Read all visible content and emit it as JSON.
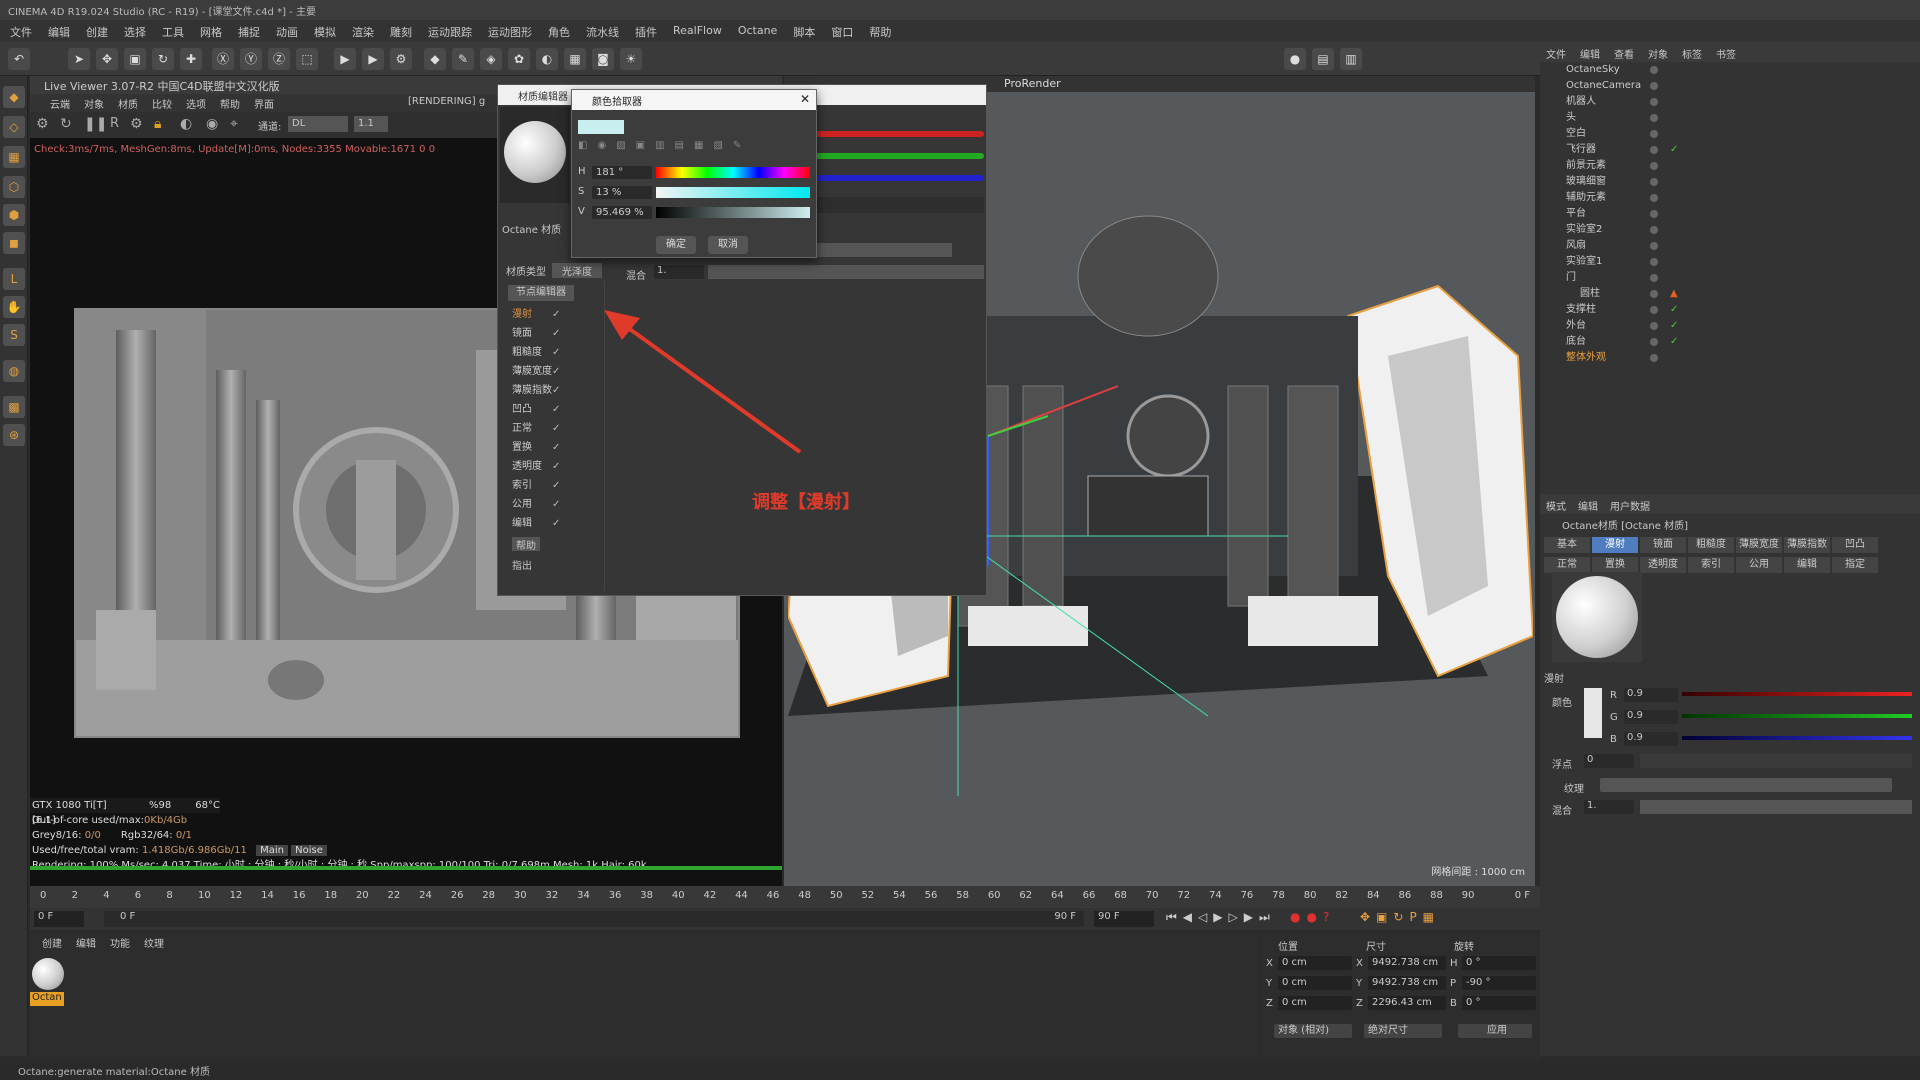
{
  "app": {
    "title": "CINEMA 4D R19.024 Studio (RC - R19) - [课堂文件.c4d *] - 主要"
  },
  "menu": [
    "文件",
    "编辑",
    "创建",
    "选择",
    "工具",
    "网格",
    "捕捉",
    "动画",
    "模拟",
    "渲染",
    "雕刻",
    "运动跟踪",
    "运动图形",
    "角色",
    "流水线",
    "插件",
    "RealFlow",
    "Octane",
    "脚本",
    "窗口",
    "帮助"
  ],
  "liveviewer": {
    "title": "Live Viewer 3.07-R2 中国C4D联盟中文汉化版",
    "menu": [
      "云端",
      "对象",
      "材质",
      "比较",
      "选项",
      "帮助",
      "界面"
    ],
    "rendering_label": "[RENDERING] g",
    "channel_label": "通道:",
    "channel_value": "DL",
    "zoom_value": "1.1",
    "status": "Check:3ms/7ms, MeshGen:8ms, Update[M]:0ms, Nodes:3355 Movable:1671  0 0",
    "gpu": "GTX 1080 Ti[T][6.1]",
    "gpu_util": "%98",
    "gpu_temp": "68°C",
    "outofcore_label": "Out-of-core used/max:",
    "outofcore_value": "0Kb/4Gb",
    "grey_label": "Grey8/16:",
    "grey_value": "0/0",
    "rgb_label": "Rgb32/64:",
    "rgb_value": "0/1",
    "vram_label": "Used/free/total vram:",
    "vram_value": "1.418Gb/6.986Gb/11",
    "main_btn": "Main",
    "noise_btn": "Noise",
    "render_line": "Rendering: 100%   Ms/sec: 4.037    Time: 小时 : 分钟 : 秒/小时 : 分钟 : 秒    Spp/maxspp: 100/100      Tri: 0/7.698m  Mesh: 1k    Hair: 60k",
    "progress": 100
  },
  "viewport": {
    "title": "ProRender",
    "grid_label": "网格间距 : 1000 cm"
  },
  "material_editor": {
    "title": "材质编辑器",
    "material_name": "Octane 材质",
    "type_label": "材质类型",
    "type_value": "光泽度",
    "node_editor_btn": "节点编辑器",
    "mix_label": "混合",
    "mix_value": "1.",
    "channels": [
      "漫射",
      "镜面",
      "粗糙度",
      "薄膜宽度",
      "薄膜指数",
      "凹凸",
      "正常",
      "置换",
      "透明度",
      "索引",
      "公用",
      "编辑"
    ],
    "help_btn": "帮助",
    "assign_label": "指出"
  },
  "color_picker": {
    "title": "颜色拾取器",
    "h_label": "H",
    "h_value": "181 °",
    "s_label": "S",
    "s_value": "13 %",
    "v_label": "V",
    "v_value": "95.469 %",
    "ok_btn": "确定",
    "cancel_btn": "取消",
    "swatch_color": "#c9eef0"
  },
  "annotation": "调整【漫射】",
  "objects": {
    "header": [
      "文件",
      "编辑",
      "查看",
      "对象",
      "标签",
      "书签"
    ],
    "items": [
      "OctaneSky",
      "OctaneCamera",
      "机器人",
      "头",
      "空白",
      "飞行器",
      "前景元素",
      "玻璃细窗",
      "辅助元素",
      "平台",
      "实验室2",
      "风扇",
      "实验室1",
      "门",
      "圆柱",
      "支撑柱",
      "外台",
      "底台",
      "整体外观"
    ]
  },
  "attributes": {
    "header": [
      "模式",
      "编辑",
      "用户数据"
    ],
    "title": "Octane材质 [Octane 材质]",
    "tabs_row1": [
      "基本",
      "漫射",
      "镜面",
      "粗糙度",
      "薄膜宽度",
      "薄膜指数",
      "凹凸"
    ],
    "tabs_row2": [
      "正常",
      "置换",
      "透明度",
      "索引",
      "公用",
      "编辑",
      "指定"
    ],
    "section": "漫射",
    "color_label": "颜色",
    "r_label": "R",
    "r_value": "0.9",
    "g_label": "G",
    "g_value": "0.9",
    "b_label": "B",
    "b_value": "0.9",
    "float_label": "浮点",
    "float_value": "0",
    "texture_label": "纹理",
    "mix_label": "混合",
    "mix_value": "1."
  },
  "timeline": {
    "ticks": [
      "0",
      "2",
      "4",
      "6",
      "8",
      "10",
      "12",
      "14",
      "16",
      "18",
      "20",
      "22",
      "24",
      "26",
      "28",
      "30",
      "32",
      "34",
      "36",
      "38",
      "40",
      "42",
      "44",
      "46",
      "48",
      "50",
      "52",
      "54",
      "56",
      "58",
      "60",
      "62",
      "64",
      "66",
      "68",
      "70",
      "72",
      "74",
      "76",
      "78",
      "80",
      "82",
      "84",
      "86",
      "88",
      "90"
    ],
    "current_frame": "0 F",
    "start_frame": "0 F",
    "start_field": "0 F",
    "end_field": "90 F",
    "end_frame": "90 F"
  },
  "material_manager": {
    "menu": [
      "创建",
      "编辑",
      "功能",
      "纹理"
    ],
    "material_label": "Octan"
  },
  "coords": {
    "headers": [
      "位置",
      "尺寸",
      "旋转"
    ],
    "x_pos": "0 cm",
    "y_pos": "0 cm",
    "z_pos": "0 cm",
    "x_size": "9492.738 cm",
    "y_size": "9492.738 cm",
    "z_size": "2296.43 cm",
    "h_rot": "0 °",
    "p_rot": "-90 °",
    "b_rot": "0 °",
    "mode1": "对象 (相对)",
    "mode2": "绝对尺寸",
    "apply_btn": "应用"
  },
  "statusbar": "Octane:generate material:Octane 材质",
  "colors": {
    "accent": "#4f7dbf",
    "annotation": "#e03a2a",
    "progress": "#2fa52f"
  }
}
